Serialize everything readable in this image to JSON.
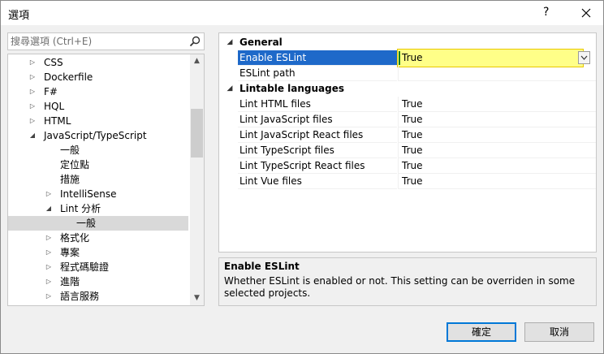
{
  "window": {
    "title": "選項",
    "help_label": "?",
    "close_icon": "close-icon"
  },
  "search": {
    "placeholder": "搜尋選項 (Ctrl+E)",
    "icon": "search-icon"
  },
  "tree": {
    "items": [
      {
        "label": "CSS",
        "arrow": "collapsed"
      },
      {
        "label": "Dockerfile",
        "arrow": "collapsed"
      },
      {
        "label": "F#",
        "arrow": "collapsed"
      },
      {
        "label": "HQL",
        "arrow": "collapsed"
      },
      {
        "label": "HTML",
        "arrow": "collapsed"
      },
      {
        "label": "JavaScript/TypeScript",
        "arrow": "expanded"
      },
      {
        "label": "一般",
        "arrow": "none"
      },
      {
        "label": "定位點",
        "arrow": "none"
      },
      {
        "label": "措施",
        "arrow": "none"
      },
      {
        "label": "IntelliSense",
        "arrow": "collapsed"
      },
      {
        "label": "Lint 分析",
        "arrow": "expanded"
      },
      {
        "label": "一般",
        "arrow": "none",
        "selected": true
      },
      {
        "label": "格式化",
        "arrow": "collapsed"
      },
      {
        "label": "專案",
        "arrow": "collapsed"
      },
      {
        "label": "程式碼驗證",
        "arrow": "collapsed"
      },
      {
        "label": "進階",
        "arrow": "collapsed"
      },
      {
        "label": "語言服務",
        "arrow": "collapsed"
      }
    ]
  },
  "grid": {
    "categories": [
      {
        "label": "General",
        "properties": [
          {
            "name": "Enable ESLint",
            "value": "True",
            "selected": true,
            "editing": true
          },
          {
            "name": "ESLint path",
            "value": ""
          }
        ]
      },
      {
        "label": "Lintable languages",
        "properties": [
          {
            "name": "Lint HTML files",
            "value": "True"
          },
          {
            "name": "Lint JavaScript files",
            "value": "True"
          },
          {
            "name": "Lint JavaScript React files",
            "value": "True"
          },
          {
            "name": "Lint TypeScript files",
            "value": "True"
          },
          {
            "name": "Lint TypeScript React files",
            "value": "True"
          },
          {
            "name": "Lint Vue files",
            "value": "True"
          }
        ]
      }
    ]
  },
  "description": {
    "title": "Enable ESLint",
    "text": "Whether ESLint is enabled or not. This setting can be overriden in some selected projects."
  },
  "buttons": {
    "ok": "確定",
    "cancel": "取消"
  },
  "colors": {
    "selection": "#1e69c9",
    "edit_highlight": "#ffff88",
    "edit_border": "#e8c800",
    "primary_border": "#0078d7"
  }
}
